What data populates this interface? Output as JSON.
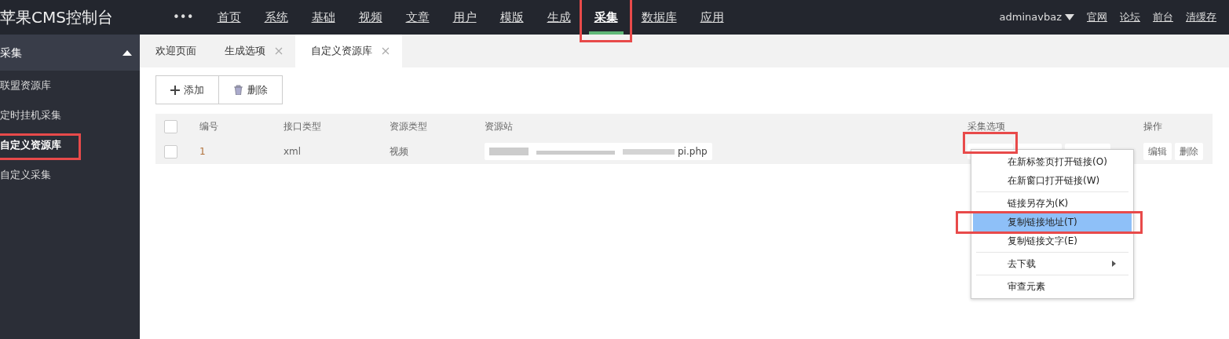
{
  "brand": "苹果CMS控制台",
  "more": "•••",
  "nav": [
    {
      "label": "首页",
      "selected": false
    },
    {
      "label": "系统",
      "selected": false
    },
    {
      "label": "基础",
      "selected": false
    },
    {
      "label": "视频",
      "selected": false
    },
    {
      "label": "文章",
      "selected": false
    },
    {
      "label": "用户",
      "selected": false
    },
    {
      "label": "模版",
      "selected": false
    },
    {
      "label": "生成",
      "selected": false
    },
    {
      "label": "采集",
      "selected": true
    },
    {
      "label": "数据库",
      "selected": false
    },
    {
      "label": "应用",
      "selected": false
    }
  ],
  "user": "adminavbaz",
  "top_links": [
    "官网",
    "论坛",
    "前台",
    "清缓存"
  ],
  "sidebar": {
    "title": "采集",
    "expanded": true,
    "items": [
      {
        "label": "联盟资源库",
        "selected": false
      },
      {
        "label": "定时挂机采集",
        "selected": false
      },
      {
        "label": "自定义资源库",
        "selected": true
      },
      {
        "label": "自定义采集",
        "selected": false
      }
    ]
  },
  "tabs": [
    {
      "label": "欢迎页面",
      "closable": false,
      "selected": false
    },
    {
      "label": "生成选项",
      "closable": true,
      "selected": false
    },
    {
      "label": "自定义资源库",
      "closable": true,
      "selected": true
    }
  ],
  "toolbar": [
    {
      "kind": "add",
      "label": "添加"
    },
    {
      "kind": "delete",
      "label": "删除"
    }
  ],
  "table": {
    "columns": [
      "编号",
      "接口类型",
      "资源类型",
      "资源站",
      "采集选项",
      "操作"
    ],
    "all_checked": false,
    "rows": [
      {
        "checked": false,
        "id": "1",
        "api": "xml",
        "type": "视频",
        "site": "pi.php",
        "actions": [
          "编辑",
          "删除"
        ]
      }
    ]
  },
  "context_menu": [
    {
      "kind": "item",
      "label": "在新标签页打开链接(O)",
      "selected": false
    },
    {
      "kind": "item",
      "label": "在新窗口打开链接(W)",
      "selected": false
    },
    {
      "kind": "divider"
    },
    {
      "kind": "item",
      "label": "链接另存为(K)",
      "selected": false
    },
    {
      "kind": "item",
      "label": "复制链接地址(T)",
      "selected": true
    },
    {
      "kind": "item",
      "label": "复制链接文字(E)",
      "selected": false
    },
    {
      "kind": "divider"
    },
    {
      "kind": "submenu",
      "label": "去下载",
      "selected": false
    },
    {
      "kind": "divider"
    },
    {
      "kind": "item",
      "label": "审查元素",
      "selected": false
    }
  ]
}
